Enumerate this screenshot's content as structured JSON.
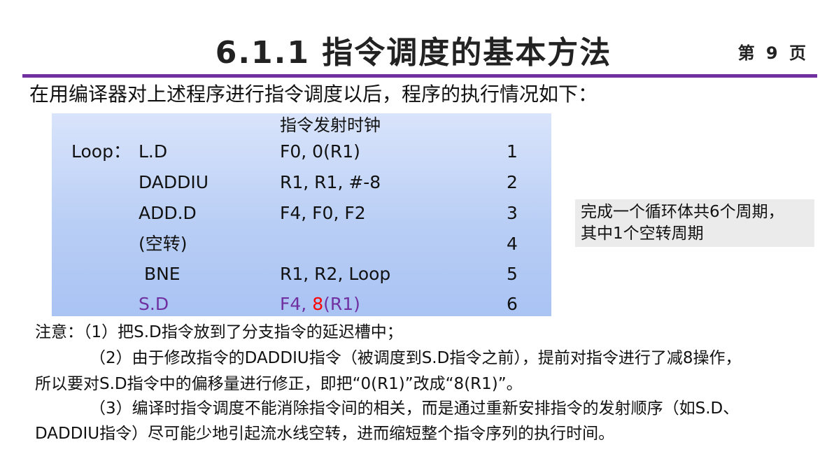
{
  "header": {
    "title": "6.1.1 指令调度的基本方法",
    "page_label": "第 9 页"
  },
  "intro": "在用编译器对上述程序进行指令调度以后，程序的执行情况如下：",
  "table": {
    "header": "指令发射时钟",
    "rows": [
      {
        "label": "Loop：",
        "op": "L.D",
        "operands": "F0, 0(R1)",
        "clock": "1"
      },
      {
        "label": "",
        "op": "DADDIU",
        "operands": "R1, R1, #-8",
        "clock": "2"
      },
      {
        "label": "",
        "op": "ADD.D",
        "operands": "F4, F0, F2",
        "clock": "3"
      },
      {
        "label": "",
        "op": "(空转)",
        "operands": "",
        "clock": "4"
      },
      {
        "label": "",
        "op": " BNE",
        "operands": "R1, R2, Loop",
        "clock": "5"
      },
      {
        "label": "",
        "op": "S.D",
        "operands_prefix": "F4, ",
        "operands_highlight": "8",
        "operands_suffix": "(R1)",
        "clock": "6"
      }
    ],
    "colors": {
      "highlight_purple": "#7030a0",
      "highlight_red": "#ff0000"
    }
  },
  "note_box": {
    "line1": "完成一个循环体共6个周期，",
    "line2": "其中1个空转周期"
  },
  "notes": {
    "line1": "注意：（1）把S.D指令放到了分支指令的延迟槽中；",
    "line2": "（2）由于修改指令的DADDIU指令（被调度到S.D指令之前），提前对指令进行了减8操作，",
    "line3": "所以要对S.D指令中的偏移量进行修正，即把“0(R1)”改成“8(R1)”。",
    "line4": "（3）编译时指令调度不能消除指令间的相关，而是通过重新安排指令的发射顺序（如S.D、",
    "line5": "DADDIU指令）尽可能少地引起流水线空转，进而缩短整个指令序列的执行时间。"
  },
  "theme": {
    "rule_color": "#7030a0"
  }
}
